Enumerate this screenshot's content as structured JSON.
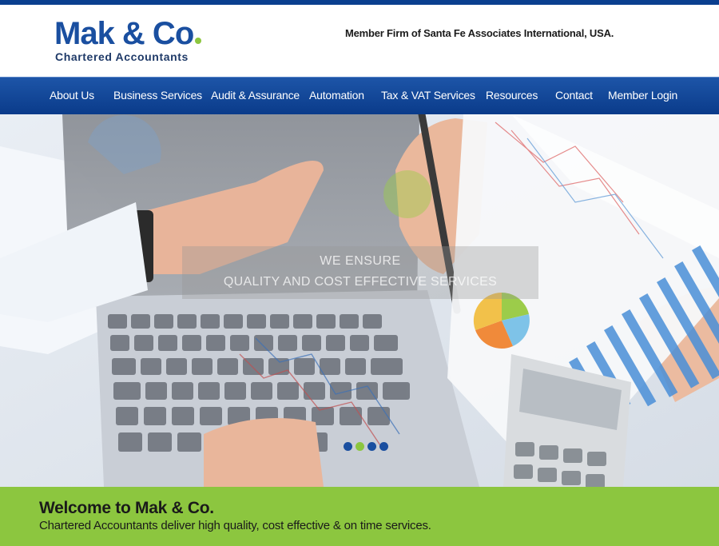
{
  "header": {
    "logo_main": "Mak & Co",
    "logo_sub": "Chartered Accountants",
    "tagline": "Member Firm of Santa Fe Associates International, USA."
  },
  "nav": {
    "items": [
      {
        "label": "About Us"
      },
      {
        "label": "Business Services"
      },
      {
        "label": "Audit & Assurance"
      },
      {
        "label": "Automation"
      },
      {
        "label": "Tax & VAT Services"
      },
      {
        "label": "Resources"
      },
      {
        "label": "Contact"
      },
      {
        "label": "Member Login"
      }
    ]
  },
  "hero": {
    "caption_line1": "WE ENSURE",
    "caption_line2": "QUALITY AND COST EFFECTIVE SERVICES",
    "active_slide": 2,
    "slide_count": 4
  },
  "welcome": {
    "title": "Welcome to Mak & Co.",
    "text": "Chartered Accountants deliver high quality, cost effective & on time services."
  },
  "colors": {
    "brand_blue": "#1a4fa0",
    "nav_blue": "#0a3b8a",
    "accent_green": "#8cc63f"
  }
}
